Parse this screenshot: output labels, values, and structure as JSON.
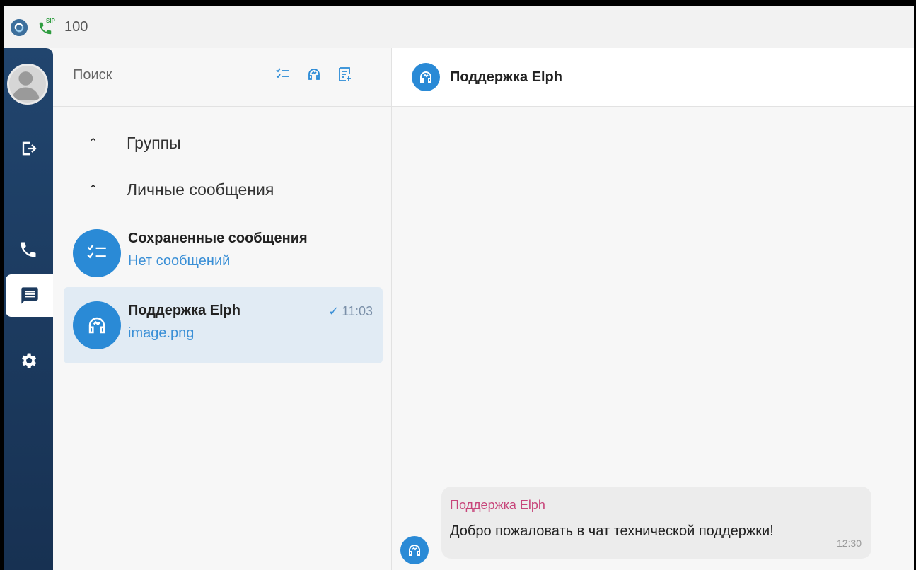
{
  "titlebar": {
    "sip_badge": "SIP",
    "extension": "100"
  },
  "colors": {
    "sidebar": "#1c3a5e",
    "accent": "#2a8ad6",
    "selected_row": "#e1ebf4",
    "sender_name": "#c7457a",
    "preview_link": "#3a8fd6"
  },
  "sidebar": {
    "items": [
      {
        "name": "avatar",
        "icon": "user-avatar-icon"
      },
      {
        "name": "logout",
        "icon": "logout-icon"
      },
      {
        "name": "calls",
        "icon": "phone-icon"
      },
      {
        "name": "chats",
        "icon": "chat-icon",
        "active": true
      },
      {
        "name": "settings",
        "icon": "gear-icon"
      }
    ]
  },
  "search": {
    "placeholder": "Поиск",
    "value": ""
  },
  "toolbar": {
    "icons": [
      "checklist-icon",
      "support-headset-icon",
      "new-chat-icon"
    ]
  },
  "sections": [
    {
      "label": "Группы",
      "expanded": true
    },
    {
      "label": "Личные сообщения",
      "expanded": true
    }
  ],
  "chats": [
    {
      "name": "Сохраненные сообщения",
      "preview": "Нет сообщений",
      "time": "",
      "icon": "checklist-icon",
      "selected": false
    },
    {
      "name": "Поддержка Elph",
      "preview": "image.png",
      "time": "11:03",
      "read": true,
      "icon": "support-headset-icon",
      "selected": true
    }
  ],
  "conversation": {
    "title": "Поддержка Elph",
    "messages": [
      {
        "sender": "Поддержка Elph",
        "text": "Добро пожаловать в чат технической поддержки!",
        "time": "12:30"
      }
    ]
  }
}
